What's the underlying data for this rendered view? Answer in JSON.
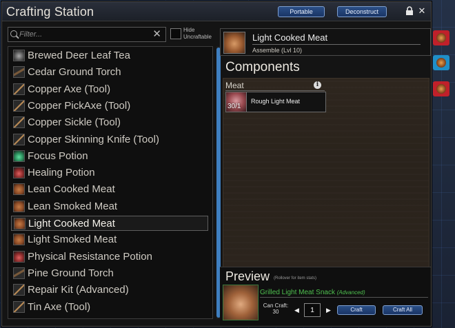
{
  "window": {
    "title": "Crafting Station",
    "buttons": {
      "portable": "Portable",
      "deconstruct": "Deconstruct"
    }
  },
  "filter": {
    "placeholder": "Filter...",
    "hide_uncraftable_label": "Hide Uncraftable",
    "hide_uncraftable_checked": false
  },
  "recipes": [
    {
      "label": "Brewed Deer Leaf Tea",
      "icon": "tea-icon",
      "selected": false
    },
    {
      "label": "Cedar Ground Torch",
      "icon": "torch-icon",
      "selected": false
    },
    {
      "label": "Copper Axe (Tool)",
      "icon": "axe-icon",
      "selected": false
    },
    {
      "label": "Copper PickAxe (Tool)",
      "icon": "pickaxe-icon",
      "selected": false
    },
    {
      "label": "Copper Sickle (Tool)",
      "icon": "sickle-icon",
      "selected": false
    },
    {
      "label": "Copper Skinning Knife (Tool)",
      "icon": "knife-icon",
      "selected": false
    },
    {
      "label": "Focus Potion",
      "icon": "green-potion-icon",
      "selected": false
    },
    {
      "label": "Healing Potion",
      "icon": "red-potion-icon",
      "selected": false
    },
    {
      "label": "Lean Cooked Meat",
      "icon": "meat-icon",
      "selected": false
    },
    {
      "label": "Lean Smoked Meat",
      "icon": "meat-icon",
      "selected": false
    },
    {
      "label": "Light Cooked Meat",
      "icon": "meat-icon",
      "selected": true
    },
    {
      "label": "Light Smoked Meat",
      "icon": "meat-icon",
      "selected": false
    },
    {
      "label": "Physical Resistance Potion",
      "icon": "red-potion-icon",
      "selected": false
    },
    {
      "label": "Pine Ground Torch",
      "icon": "torch-icon",
      "selected": false
    },
    {
      "label": "Repair Kit (Advanced)",
      "icon": "hammer-icon",
      "selected": false
    },
    {
      "label": "Tin Axe (Tool)",
      "icon": "axe-icon",
      "selected": false
    }
  ],
  "product": {
    "name": "Light Cooked Meat",
    "subtitle": "Assemble (Lvl 10)",
    "icon": "cooked-meat-icon"
  },
  "components": {
    "title": "Components",
    "slots": [
      {
        "label": "Meat",
        "count": "30/1",
        "item": "Rough Light Meat",
        "icon": "raw-meat-icon"
      }
    ]
  },
  "preview": {
    "title": "Preview",
    "hint": "(Rollover for item stats)",
    "item_name": "Grilled Light Meat Snack",
    "item_tag": "(Advanced)",
    "can_craft_label": "Can Craft:",
    "can_craft_value": "30",
    "quantity": "1",
    "craft_label": "Craft",
    "craft_all_label": "Craft All"
  },
  "colors": {
    "accent_blue": "#3f7fc0",
    "preview_green": "#4fc04f",
    "side_tab_red": "#c0202a",
    "side_tab_blue": "#1f8fc8"
  }
}
